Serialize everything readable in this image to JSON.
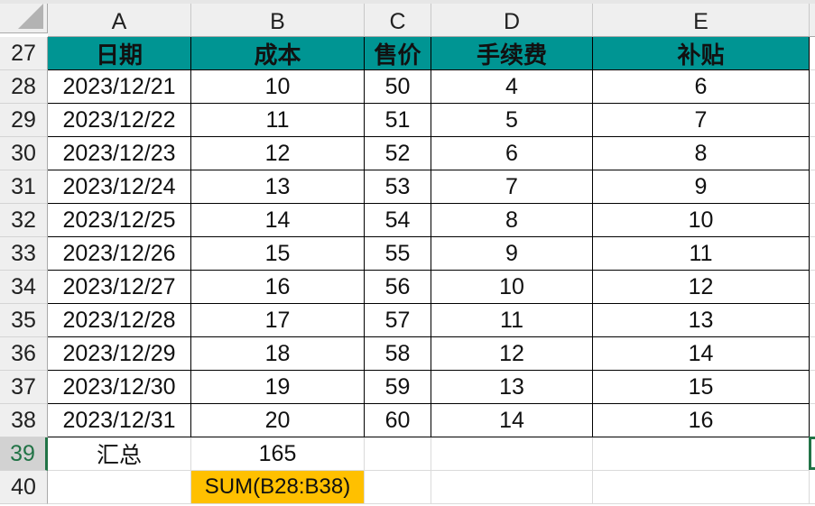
{
  "columns": [
    "A",
    "B",
    "C",
    "D",
    "E"
  ],
  "header_row": {
    "row_number": "27",
    "cells": [
      "日期",
      "成本",
      "售价",
      "手续费",
      "补贴"
    ]
  },
  "rows": [
    {
      "row_number": "28",
      "cells": [
        "2023/12/21",
        "10",
        "50",
        "4",
        "6"
      ]
    },
    {
      "row_number": "29",
      "cells": [
        "2023/12/22",
        "11",
        "51",
        "5",
        "7"
      ]
    },
    {
      "row_number": "30",
      "cells": [
        "2023/12/23",
        "12",
        "52",
        "6",
        "8"
      ]
    },
    {
      "row_number": "31",
      "cells": [
        "2023/12/24",
        "13",
        "53",
        "7",
        "9"
      ]
    },
    {
      "row_number": "32",
      "cells": [
        "2023/12/25",
        "14",
        "54",
        "8",
        "10"
      ]
    },
    {
      "row_number": "33",
      "cells": [
        "2023/12/26",
        "15",
        "55",
        "9",
        "11"
      ]
    },
    {
      "row_number": "34",
      "cells": [
        "2023/12/27",
        "16",
        "56",
        "10",
        "12"
      ]
    },
    {
      "row_number": "35",
      "cells": [
        "2023/12/28",
        "17",
        "57",
        "11",
        "13"
      ]
    },
    {
      "row_number": "36",
      "cells": [
        "2023/12/29",
        "18",
        "58",
        "12",
        "14"
      ]
    },
    {
      "row_number": "37",
      "cells": [
        "2023/12/30",
        "19",
        "59",
        "13",
        "15"
      ]
    },
    {
      "row_number": "38",
      "cells": [
        "2023/12/31",
        "20",
        "60",
        "14",
        "16"
      ]
    }
  ],
  "summary_row": {
    "row_number": "39",
    "label": "汇总",
    "total": "165"
  },
  "formula_row": {
    "row_number": "40",
    "formula_text": "SUM(B28:B38)"
  },
  "selected_cell": "F39",
  "colors": {
    "header_fill": "#009593",
    "formula_fill": "#ffc000",
    "selection": "#217346"
  }
}
